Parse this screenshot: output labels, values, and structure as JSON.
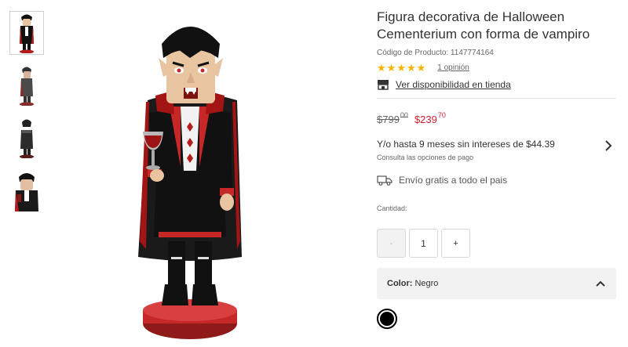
{
  "product": {
    "title": "Figura decorativa de Halloween Cementerium con forma de vampiro",
    "code_label": "Código de Producto: 1147774164",
    "rating_stars": 5,
    "reviews_text": "1 opinión",
    "store_availability": "Ver disponibilidad en tienda"
  },
  "price": {
    "old_main": "$799",
    "old_cents": "00",
    "new_main": "$239",
    "new_cents": "70"
  },
  "installments": {
    "text": "Y/o hasta 9 meses sin intereses de $44.39",
    "subtext": "Consulta las opciones de pago"
  },
  "shipping": {
    "text": "Envío gratis a todo el pais"
  },
  "quantity": {
    "label": "Cantidad:",
    "minus": "-",
    "value": "1",
    "plus": "+"
  },
  "color": {
    "label": "Color:",
    "value": "Negro",
    "swatch_hex": "#000000"
  },
  "theme": {
    "sale_red": "#d3202f",
    "star_gold": "#f5b301",
    "panel_gray": "#f2f2f2"
  },
  "icons": {
    "chevron_right": "chevron-right-icon",
    "chevron_up": "chevron-up-icon",
    "store": "store-icon",
    "truck": "truck-icon",
    "star": "star-icon"
  }
}
